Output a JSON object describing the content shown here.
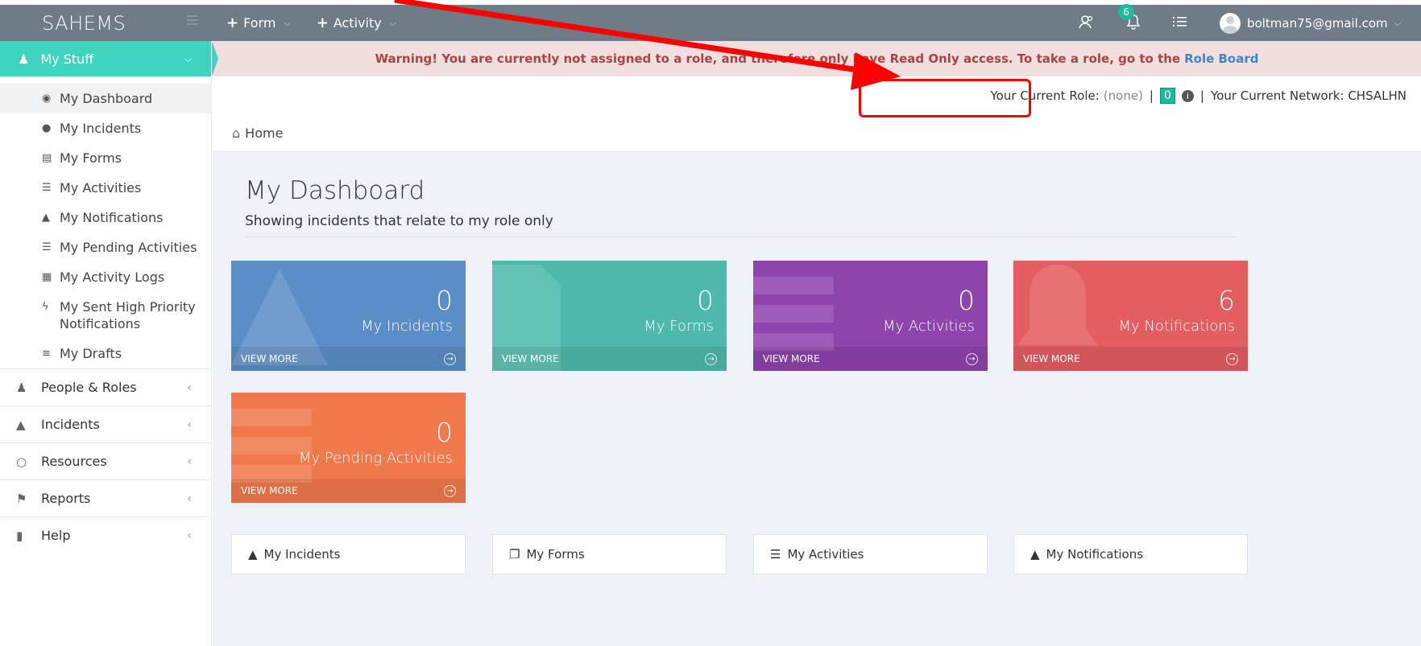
{
  "app": {
    "brand": "SAHEMS"
  },
  "topbar": {
    "menu": [
      {
        "icon": "plus-icon",
        "label": "Form"
      },
      {
        "icon": "plus-icon",
        "label": "Activity"
      }
    ],
    "notification_count": "6",
    "user_email": "boltman75@gmail.com"
  },
  "sidebar": {
    "head_label": "My Stuff",
    "items": [
      {
        "label": "My Dashboard",
        "icon": "dashboard-icon",
        "active": true
      },
      {
        "label": "My Incidents",
        "icon": "info-icon"
      },
      {
        "label": "My Forms",
        "icon": "file-icon"
      },
      {
        "label": "My Activities",
        "icon": "tasks-icon"
      },
      {
        "label": "My Notifications",
        "icon": "bell-icon"
      },
      {
        "label": "My Pending Activities",
        "icon": "tasks-icon"
      },
      {
        "label": "My Activity Logs",
        "icon": "table-icon"
      },
      {
        "label": "My Sent High Priority Notifications",
        "icon": "bolt-icon"
      },
      {
        "label": "My Drafts",
        "icon": "list-icon"
      }
    ],
    "sections": [
      {
        "label": "People & Roles",
        "icon": "users-icon"
      },
      {
        "label": "Incidents",
        "icon": "warning-icon"
      },
      {
        "label": "Resources",
        "icon": "lightbulb-icon"
      },
      {
        "label": "Reports",
        "icon": "flag-icon"
      },
      {
        "label": "Help",
        "icon": "bookmark-icon"
      }
    ]
  },
  "warning": {
    "text": "Warning! You are currently not assigned to a role, and therefore only have Read Only access. To take a role, go to the",
    "link": "Role Board"
  },
  "rolebar": {
    "role_label": "Your Current Role:",
    "role_value": "(none)",
    "role_count": "0",
    "network_label": "Your Current Network: CHSALHN"
  },
  "breadcrumb": {
    "home": "Home"
  },
  "dashboard": {
    "title": "My Dashboard",
    "subtitle": "Showing incidents that relate to my role only",
    "view_more": "VIEW MORE",
    "tiles": [
      {
        "value": "0",
        "label": "My Incidents",
        "color": "#5b8ec7"
      },
      {
        "value": "0",
        "label": "My Forms",
        "color": "#4cb9ab"
      },
      {
        "value": "0",
        "label": "My Activities",
        "color": "#8e44ad"
      },
      {
        "value": "6",
        "label": "My Notifications",
        "color": "#e35d61"
      },
      {
        "value": "0",
        "label": "My Pending Activities",
        "color": "#f0794c"
      }
    ],
    "panels": [
      {
        "label": "My Incidents",
        "icon": "warning-icon"
      },
      {
        "label": "My Forms",
        "icon": "copy-icon"
      },
      {
        "label": "My Activities",
        "icon": "tasks-icon"
      },
      {
        "label": "My Notifications",
        "icon": "bell-icon"
      }
    ]
  },
  "annotation": {
    "color": "#ff0000"
  }
}
